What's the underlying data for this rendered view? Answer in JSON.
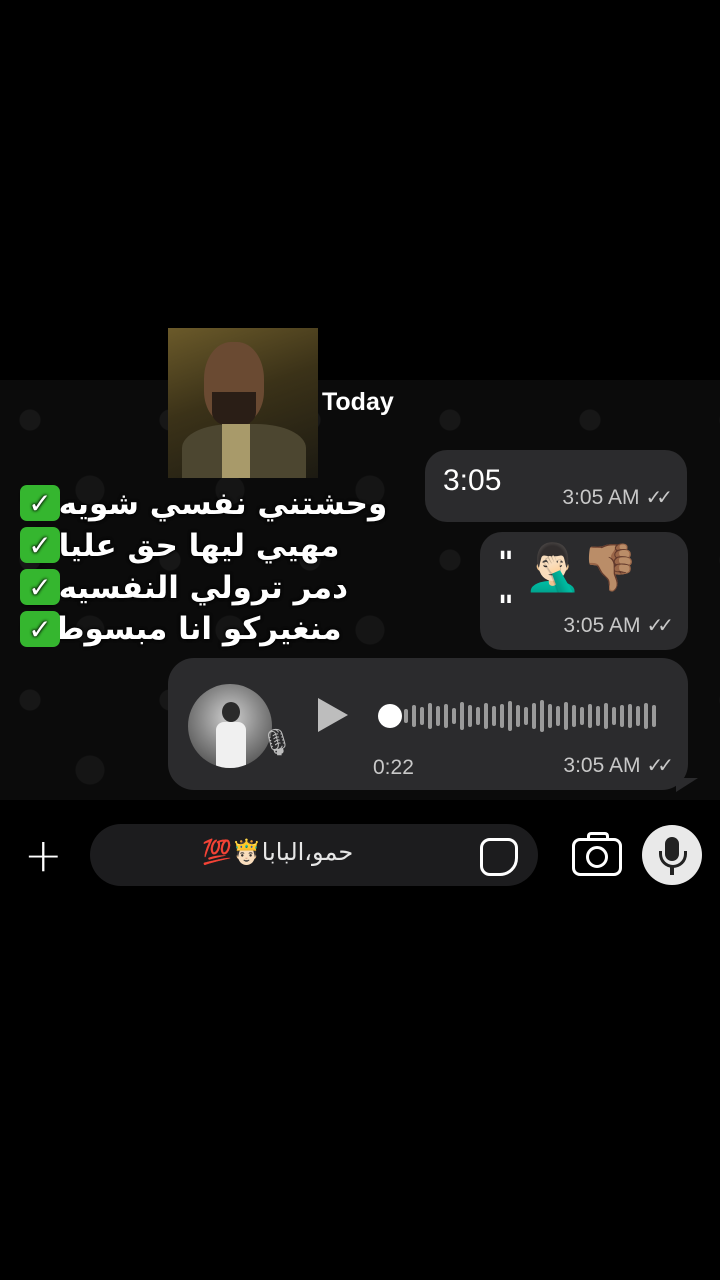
{
  "date_divider": "Today",
  "messages": [
    {
      "type": "text",
      "text": "3:05",
      "time": "3:05 AM",
      "ticks": "✓✓"
    },
    {
      "type": "emoji",
      "quote_open": "\"",
      "quote_close": "\"",
      "emojis": "🤦🏻‍♂️👎🏽",
      "time": "3:05 AM",
      "ticks": "✓✓"
    },
    {
      "type": "voice",
      "duration": "0:22",
      "time": "3:05 AM",
      "ticks": "✓✓"
    }
  ],
  "overlay": {
    "lines": [
      "وحشتني نفسي شويه💔",
      "مهيي ليها حق عليا👌🏽",
      "دمر ترولي النفسيه🤦🏻‍♂️",
      "منغيركو انا مبسوط😄"
    ],
    "check_mark": "✓"
  },
  "input": {
    "text": "حمو،البابا🤴🏻💯",
    "plus_label": "+"
  },
  "colors": {
    "bubble": "#2b2b2d",
    "background": "#000000",
    "check_green": "#35b62f"
  }
}
